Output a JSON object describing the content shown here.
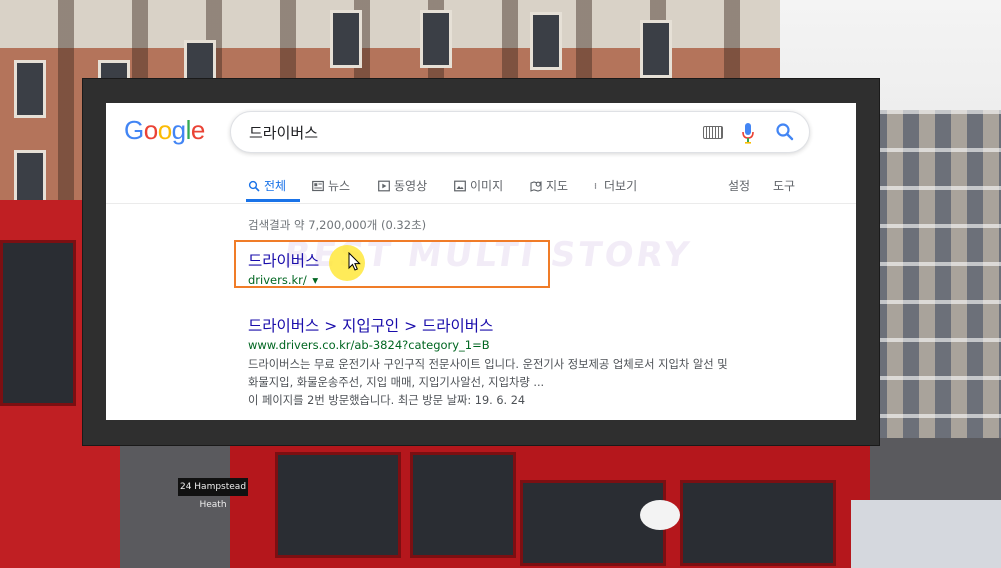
{
  "colors": {
    "google_blue": "#4285F4",
    "google_red": "#EA4335",
    "google_yellow": "#FBBC05",
    "google_green": "#34A853",
    "link": "#1a0dab",
    "url": "#006621",
    "highlight_border": "#f07c28"
  },
  "logo": {
    "letters": [
      "G",
      "o",
      "o",
      "g",
      "l",
      "e"
    ]
  },
  "search": {
    "query": "드라이버스",
    "icons": [
      "keyboard-icon",
      "mic-icon",
      "search-icon"
    ]
  },
  "tabs": [
    {
      "label": "전체",
      "icon": "search-icon",
      "active": true
    },
    {
      "label": "뉴스",
      "icon": "news-icon",
      "active": false
    },
    {
      "label": "동영상",
      "icon": "video-icon",
      "active": false
    },
    {
      "label": "이미지",
      "icon": "image-icon",
      "active": false
    },
    {
      "label": "지도",
      "icon": "map-icon",
      "active": false
    },
    {
      "label": "더보기",
      "icon": "more-icon",
      "active": false
    }
  ],
  "tools": {
    "settings_label": "설정",
    "tools_label": "도구"
  },
  "result_stats": "검색결과 약 7,200,000개 (0.32초)",
  "results": [
    {
      "title": "드라이버스",
      "url": "drivers.kr/",
      "url_arrow": "▾"
    },
    {
      "title": "드라이버스 > 지입구인 > 드라이버스",
      "url": "www.drivers.co.kr/ab-3824?category_1=B",
      "snippet_line1": "드라이버스는 무료 운전기사 구인구직 전문사이트 입니다. 운전기사 정보제공 업체로서 지입차 알선 및",
      "snippet_line2": "화물지입, 화물운송주선, 지입 매매, 지입기사알선, 지입차량 ...",
      "visit_info": "이 페이지를 2번 방문했습니다. 최근 방문 날짜: 19. 6. 24"
    }
  ],
  "watermark": "BEST MULTI STORY",
  "background": {
    "bus_sign": "24 Hampstead Heath"
  }
}
